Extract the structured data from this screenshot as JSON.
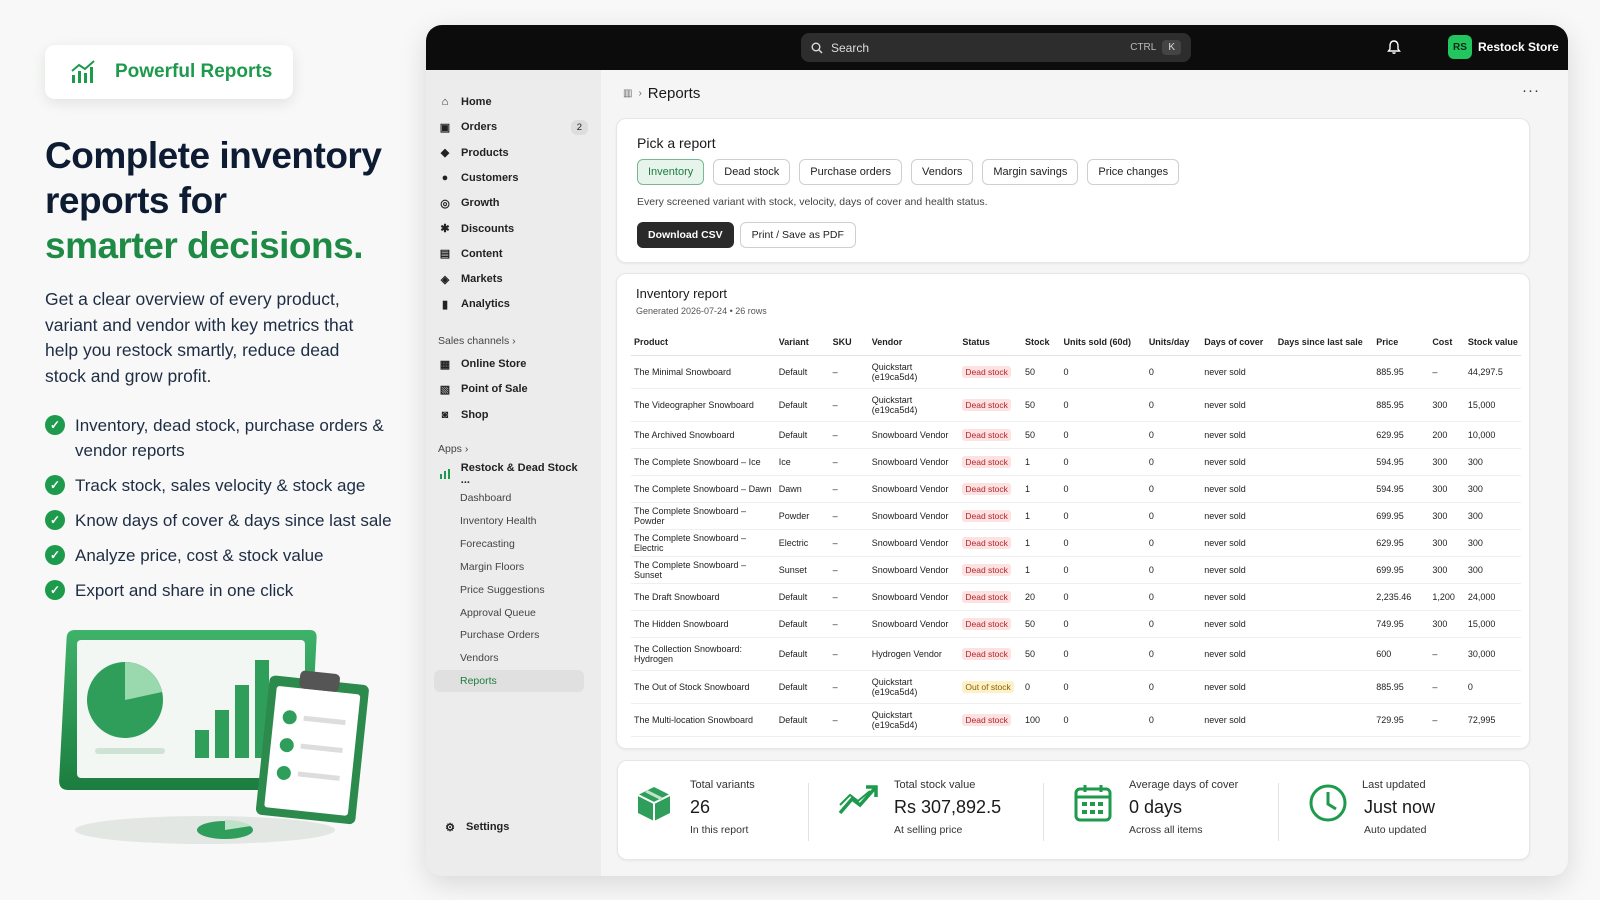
{
  "marketing": {
    "badge": "Powerful Reports",
    "headline_line1": "Complete inventory",
    "headline_line2": "reports for",
    "headline_line3": "smarter decisions.",
    "lead": "Get a clear overview of every product, variant and vendor with key metrics that help you restock smartly, reduce dead stock and grow profit.",
    "features": [
      "Inventory, dead stock, purchase orders & vendor reports",
      "Track stock, sales velocity & stock age",
      "Know days of cover & days since last sale",
      "Analyze price, cost & stock value",
      "Export and share in one click"
    ]
  },
  "topbar": {
    "search_placeholder": "Search",
    "shortcut_ctrl": "CTRL",
    "shortcut_key": "K",
    "store_initials": "RS",
    "store_name": "Restock Store"
  },
  "sidebar": {
    "main": [
      {
        "label": "Home",
        "icon": "home-icon"
      },
      {
        "label": "Orders",
        "icon": "orders-icon",
        "count": "2"
      },
      {
        "label": "Products",
        "icon": "products-icon"
      },
      {
        "label": "Customers",
        "icon": "customers-icon"
      },
      {
        "label": "Growth",
        "icon": "growth-icon"
      },
      {
        "label": "Discounts",
        "icon": "discounts-icon"
      },
      {
        "label": "Content",
        "icon": "content-icon"
      },
      {
        "label": "Markets",
        "icon": "markets-icon"
      },
      {
        "label": "Analytics",
        "icon": "analytics-icon"
      }
    ],
    "sales_channels_label": "Sales channels",
    "channels": [
      {
        "label": "Online Store",
        "icon": "online-store-icon"
      },
      {
        "label": "Point of Sale",
        "icon": "point-of-sale-icon"
      },
      {
        "label": "Shop",
        "icon": "shop-icon"
      }
    ],
    "apps_label": "Apps",
    "app_name": "Restock & Dead Stock ...",
    "app_items": [
      "Dashboard",
      "Inventory Health",
      "Forecasting",
      "Margin Floors",
      "Price Suggestions",
      "Approval Queue",
      "Purchase Orders",
      "Vendors",
      "Reports"
    ],
    "settings": "Settings"
  },
  "page": {
    "breadcrumb": "Reports",
    "more": "···"
  },
  "picker": {
    "title": "Pick a report",
    "chips": [
      "Inventory",
      "Dead stock",
      "Purchase orders",
      "Vendors",
      "Margin savings",
      "Price changes"
    ],
    "active": "Inventory",
    "description": "Every screened variant with stock, velocity, days of cover and health status.",
    "download": "Download CSV",
    "print": "Print / Save as PDF"
  },
  "report": {
    "title": "Inventory report",
    "generated": "Generated 2026-07-24 • 26 rows",
    "headers": [
      "Product",
      "Variant",
      "SKU",
      "Vendor",
      "Status",
      "Stock",
      "Units sold (60d)",
      "Units/day",
      "Days of cover",
      "Days since last sale",
      "Price",
      "Cost",
      "Stock value"
    ],
    "rows": [
      {
        "product": "The Minimal Snowboard",
        "variant": "Default",
        "sku": "–",
        "vendor": "Quickstart (e19ca5d4)",
        "status": "Dead stock",
        "stock": "50",
        "sold": "0",
        "perday": "0",
        "cover": "never sold",
        "since": "",
        "price": "885.95",
        "cost": "–",
        "value": "44,297.5"
      },
      {
        "product": "The Videographer Snowboard",
        "variant": "Default",
        "sku": "–",
        "vendor": "Quickstart (e19ca5d4)",
        "status": "Dead stock",
        "stock": "50",
        "sold": "0",
        "perday": "0",
        "cover": "never sold",
        "since": "",
        "price": "885.95",
        "cost": "300",
        "value": "15,000"
      },
      {
        "product": "The Archived Snowboard",
        "variant": "Default",
        "sku": "–",
        "vendor": "Snowboard Vendor",
        "status": "Dead stock",
        "stock": "50",
        "sold": "0",
        "perday": "0",
        "cover": "never sold",
        "since": "",
        "price": "629.95",
        "cost": "200",
        "value": "10,000"
      },
      {
        "product": "The Complete Snowboard – Ice",
        "variant": "Ice",
        "sku": "–",
        "vendor": "Snowboard Vendor",
        "status": "Dead stock",
        "stock": "1",
        "sold": "0",
        "perday": "0",
        "cover": "never sold",
        "since": "",
        "price": "594.95",
        "cost": "300",
        "value": "300"
      },
      {
        "product": "The Complete Snowboard – Dawn",
        "variant": "Dawn",
        "sku": "–",
        "vendor": "Snowboard Vendor",
        "status": "Dead stock",
        "stock": "1",
        "sold": "0",
        "perday": "0",
        "cover": "never sold",
        "since": "",
        "price": "594.95",
        "cost": "300",
        "value": "300"
      },
      {
        "product": "The Complete Snowboard – Powder",
        "variant": "Powder",
        "sku": "–",
        "vendor": "Snowboard Vendor",
        "status": "Dead stock",
        "stock": "1",
        "sold": "0",
        "perday": "0",
        "cover": "never sold",
        "since": "",
        "price": "699.95",
        "cost": "300",
        "value": "300"
      },
      {
        "product": "The Complete Snowboard – Electric",
        "variant": "Electric",
        "sku": "–",
        "vendor": "Snowboard Vendor",
        "status": "Dead stock",
        "stock": "1",
        "sold": "0",
        "perday": "0",
        "cover": "never sold",
        "since": "",
        "price": "629.95",
        "cost": "300",
        "value": "300"
      },
      {
        "product": "The Complete Snowboard – Sunset",
        "variant": "Sunset",
        "sku": "–",
        "vendor": "Snowboard Vendor",
        "status": "Dead stock",
        "stock": "1",
        "sold": "0",
        "perday": "0",
        "cover": "never sold",
        "since": "",
        "price": "699.95",
        "cost": "300",
        "value": "300"
      },
      {
        "product": "The Draft Snowboard",
        "variant": "Default",
        "sku": "–",
        "vendor": "Snowboard Vendor",
        "status": "Dead stock",
        "stock": "20",
        "sold": "0",
        "perday": "0",
        "cover": "never sold",
        "since": "",
        "price": "2,235.46",
        "cost": "1,200",
        "value": "24,000"
      },
      {
        "product": "The Hidden Snowboard",
        "variant": "Default",
        "sku": "–",
        "vendor": "Snowboard Vendor",
        "status": "Dead stock",
        "stock": "50",
        "sold": "0",
        "perday": "0",
        "cover": "never sold",
        "since": "",
        "price": "749.95",
        "cost": "300",
        "value": "15,000"
      },
      {
        "product": "The Collection Snowboard: Hydrogen",
        "variant": "Default",
        "sku": "–",
        "vendor": "Hydrogen Vendor",
        "status": "Dead stock",
        "stock": "50",
        "sold": "0",
        "perday": "0",
        "cover": "never sold",
        "since": "",
        "price": "600",
        "cost": "–",
        "value": "30,000"
      },
      {
        "product": "The Out of Stock Snowboard",
        "variant": "Default",
        "sku": "–",
        "vendor": "Quickstart (e19ca5d4)",
        "status": "Out of stock",
        "stock": "0",
        "sold": "0",
        "perday": "0",
        "cover": "never sold",
        "since": "",
        "price": "885.95",
        "cost": "–",
        "value": "0"
      },
      {
        "product": "The Multi-location Snowboard",
        "variant": "Default",
        "sku": "–",
        "vendor": "Quickstart (e19ca5d4)",
        "status": "Dead stock",
        "stock": "100",
        "sold": "0",
        "perday": "0",
        "cover": "never sold",
        "since": "",
        "price": "729.95",
        "cost": "–",
        "value": "72,995"
      }
    ]
  },
  "stats": [
    {
      "label": "Total variants",
      "value": "26",
      "sub": "In this report",
      "icon": "box-icon"
    },
    {
      "label": "Total stock value",
      "value": "Rs 307,892.5",
      "sub": "At selling price",
      "icon": "trend-up-icon"
    },
    {
      "label": "Average days of cover",
      "value": "0 days",
      "sub": "Across all items",
      "icon": "calendar-icon"
    },
    {
      "label": "Last updated",
      "value": "Just now",
      "sub": "Auto updated",
      "icon": "clock-icon"
    }
  ],
  "colors": {
    "brand_green": "#1e9a4c",
    "dead_stock": "#b4232b",
    "out_of_stock": "#8a6200"
  }
}
